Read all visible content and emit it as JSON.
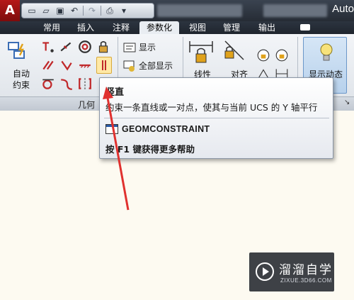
{
  "titlebar": {
    "app_letter": "A",
    "title_fragment": "Auto",
    "qat_icons": [
      "new-icon",
      "open-icon",
      "save-icon",
      "undo-icon",
      "redo-icon",
      "print-icon",
      "dropdown-icon"
    ]
  },
  "tabs": [
    {
      "label": "常用"
    },
    {
      "label": "插入"
    },
    {
      "label": "注释"
    },
    {
      "label": "参数化"
    },
    {
      "label": "视图"
    },
    {
      "label": "管理"
    },
    {
      "label": "输出"
    }
  ],
  "ribbon": {
    "auto_constrain_label": "自动\n约束",
    "show_label": "显示",
    "show_all_label": "全部显示",
    "linear_label": "线性",
    "aligned_label": "对齐",
    "show_dynamic_label": "显示动态",
    "geometric_panel_label": "几何"
  },
  "tooltip": {
    "title": "竖直",
    "description": "约束一条直线或一对点，使其与当前 UCS 的 Y 轴平行",
    "command": "GEOMCONSTRAINT",
    "help": "按 F1 键获得更多帮助"
  },
  "watermark": {
    "cn": "溜溜自学",
    "en": "ZIXUE.3D66.COM"
  },
  "colors": {
    "app_red": "#b51818",
    "title_dark": "#262c35",
    "ribbon_bg": "#e9edf2",
    "canvas_bg": "#fdfaf1",
    "annotation_arrow": "#e0312f"
  }
}
